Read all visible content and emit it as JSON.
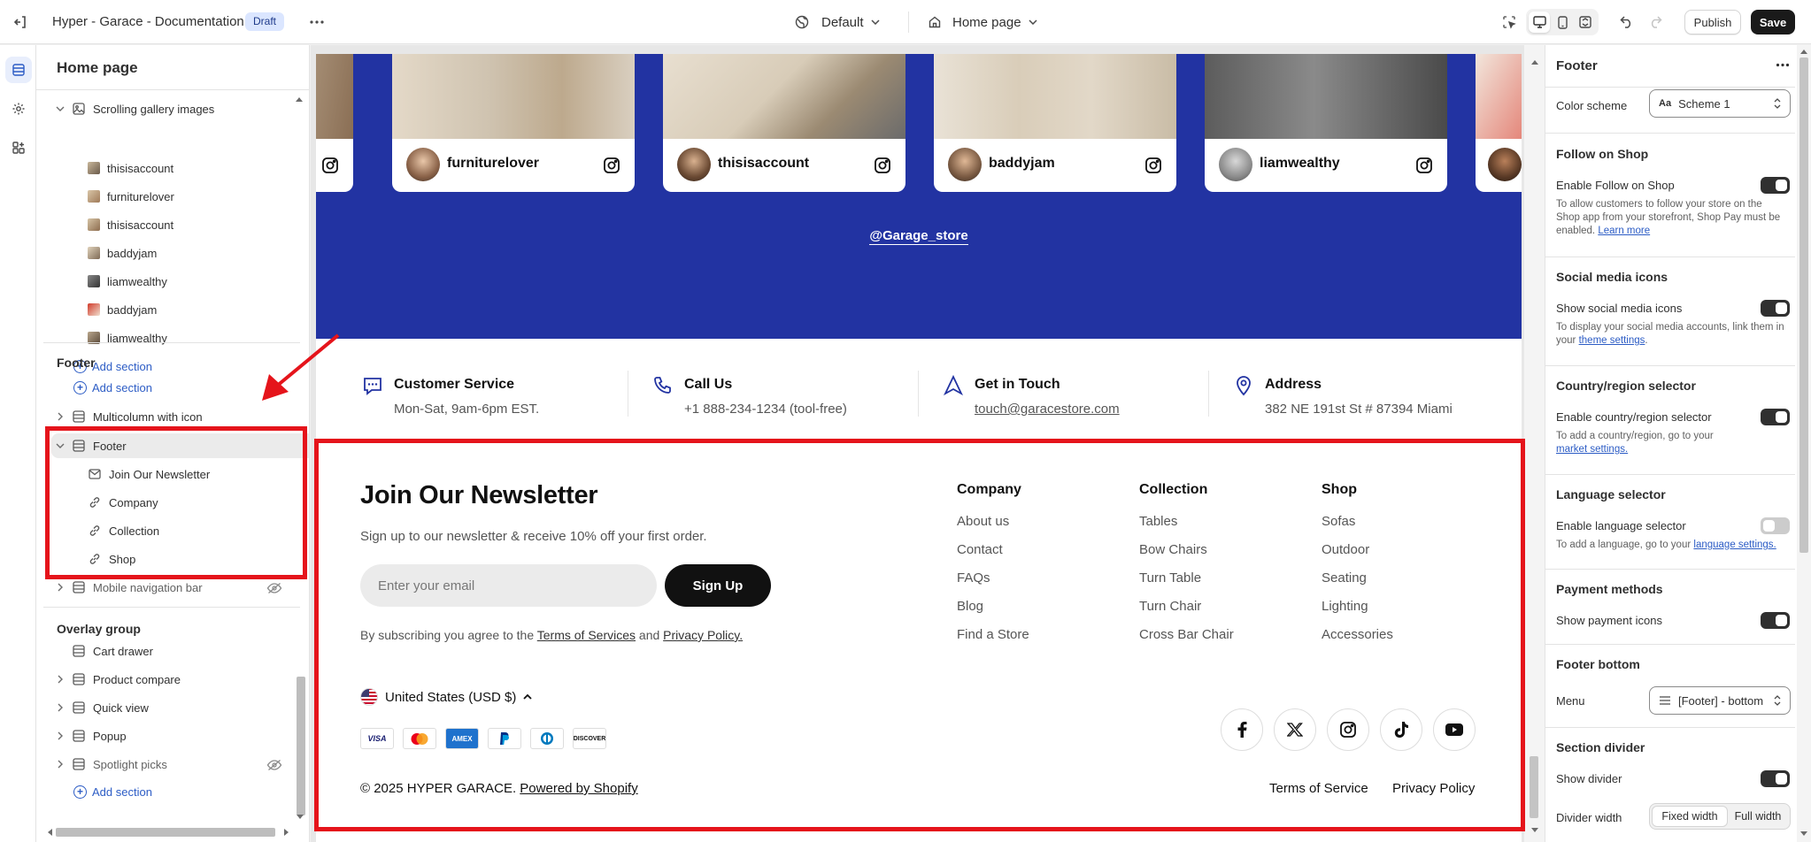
{
  "topbar": {
    "store_title": "Hyper - Garace - Documentation",
    "draft_badge": "Draft",
    "theme_select": "Default",
    "page_select": "Home page",
    "publish_label": "Publish",
    "save_label": "Save"
  },
  "sidebar": {
    "title": "Home page",
    "gallery_group": "Scrolling gallery images",
    "gallery_items": [
      "thisisaccount",
      "furniturelover",
      "thisisaccount",
      "baddyjam",
      "liamwealthy",
      "baddyjam",
      "liamwealthy"
    ],
    "add_section": "Add section",
    "footer_group_heading": "Footer",
    "multicolumn_item": "Multicolumn with icon",
    "footer_item": "Footer",
    "footer_blocks": [
      "Join Our Newsletter",
      "Company",
      "Collection",
      "Shop"
    ],
    "mobile_nav_item": "Mobile navigation bar",
    "overlay_heading": "Overlay group",
    "overlay_items": [
      "Cart drawer",
      "Product compare",
      "Quick view",
      "Popup",
      "Spotlight picks"
    ]
  },
  "preview": {
    "gallery_users": [
      "furniturelover",
      "thisisaccount",
      "baddyjam",
      "liamwealthy"
    ],
    "store_handle": "@Garage_store",
    "services": [
      {
        "title": "Customer Service",
        "text": "Mon-Sat, 9am-6pm EST.",
        "icon": "chat-icon"
      },
      {
        "title": "Call Us",
        "text": "+1 888-234-1234 (tool-free)",
        "icon": "phone-icon"
      },
      {
        "title": "Get in Touch",
        "text": "touch@garacestore.com",
        "icon": "navigation-arrow-icon"
      },
      {
        "title": "Address",
        "text": "382 NE 191st St # 87394 Miami",
        "icon": "map-pin-icon"
      }
    ],
    "newsletter": {
      "title": "Join Our Newsletter",
      "subtitle": "Sign up to our newsletter & receive 10% off your first order.",
      "email_placeholder": "Enter your email",
      "button": "Sign Up",
      "consent_prefix": "By subscribing you agree to the",
      "consent_terms": "Terms of Services",
      "consent_and": "and",
      "consent_privacy": "Privacy Policy."
    },
    "columns": [
      {
        "title": "Company",
        "links": [
          "About us",
          "Contact",
          "FAQs",
          "Blog",
          "Find a Store"
        ]
      },
      {
        "title": "Collection",
        "links": [
          "Tables",
          "Bow Chairs",
          "Turn Table",
          "Turn Chair",
          "Cross Bar Chair"
        ]
      },
      {
        "title": "Shop",
        "links": [
          "Sofas",
          "Outdoor",
          "Seating",
          "Lighting",
          "Accessories"
        ]
      }
    ],
    "currency": "United States (USD $)",
    "payment_methods": [
      "VISA",
      "Mastercard",
      "AMEX",
      "PayPal",
      "Diners",
      "DISCOVER"
    ],
    "social_icons": [
      "facebook-icon",
      "x-icon",
      "instagram-icon",
      "tiktok-icon",
      "youtube-icon"
    ],
    "copyright": "© 2025 HYPER GARACE.",
    "powered_by": "Powered by Shopify",
    "terms_link": "Terms of Service",
    "privacy_link": "Privacy Policy"
  },
  "settings": {
    "title": "Footer",
    "color_scheme_label": "Color scheme",
    "color_scheme_value": "Scheme 1",
    "follow_heading": "Follow on Shop",
    "follow_toggle_label": "Enable Follow on Shop",
    "follow_help": "To allow customers to follow your store on the Shop app from your storefront, Shop Pay must be enabled.",
    "follow_help_link": "Learn more",
    "social_heading": "Social media icons",
    "social_toggle_label": "Show social media icons",
    "social_help": "To display your social media accounts, link them in your",
    "social_help_link": "theme settings",
    "country_heading": "Country/region selector",
    "country_toggle_label": "Enable country/region selector",
    "country_help": "To add a country/region, go to your",
    "country_help_link": "market settings.",
    "language_heading": "Language selector",
    "language_toggle_label": "Enable language selector",
    "language_help": "To add a language, go to your",
    "language_help_link": "language settings.",
    "payment_heading": "Payment methods",
    "payment_toggle_label": "Show payment icons",
    "footer_bottom_heading": "Footer bottom",
    "menu_label": "Menu",
    "menu_value": "[Footer] - bottom",
    "divider_heading": "Section divider",
    "divider_toggle_label": "Show divider",
    "divider_width_label": "Divider width",
    "divider_width_options": [
      "Fixed width",
      "Full width"
    ]
  },
  "colors": {
    "accent": "#2233a2",
    "annotation": "#e5141b",
    "link": "#2c5cc5"
  }
}
